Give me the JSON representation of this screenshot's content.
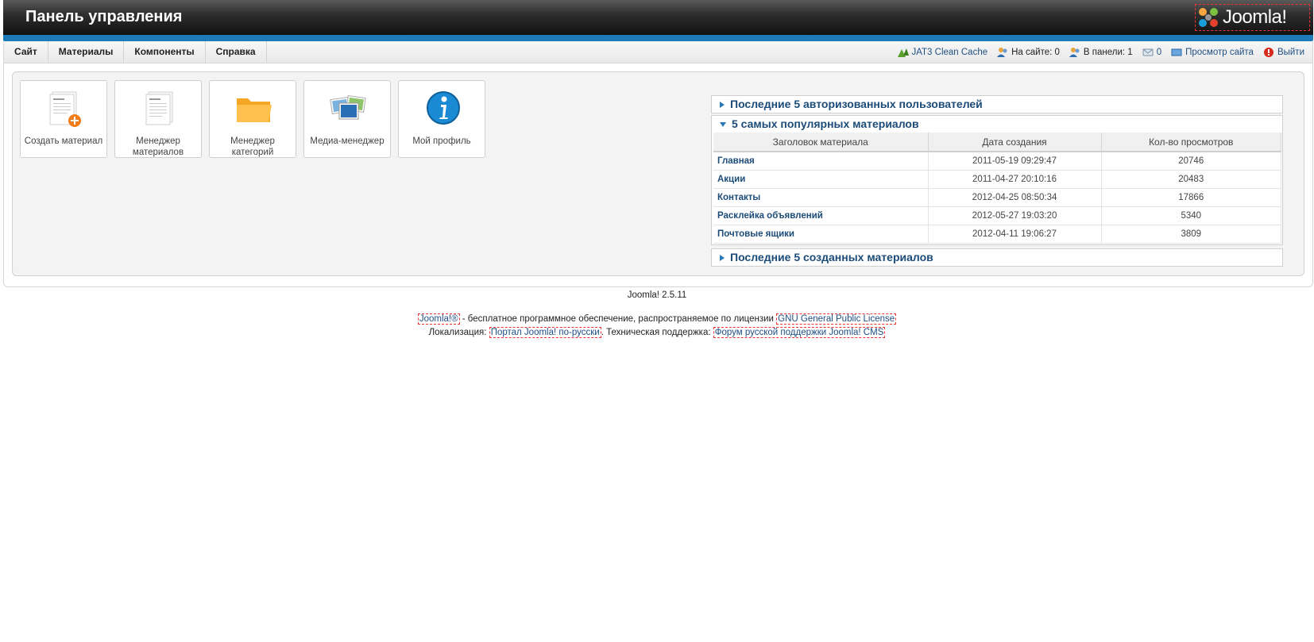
{
  "header": {
    "title": "Панель управления",
    "logo_text": "Joomla!"
  },
  "menu": {
    "items": [
      "Сайт",
      "Материалы",
      "Компоненты",
      "Справка"
    ]
  },
  "status": {
    "cache": "JAT3 Clean Cache",
    "on_site": "На сайте: 0",
    "in_panel": "В панели: 1",
    "messages": "0",
    "view_site": "Просмотр сайта",
    "logout": "Выйти"
  },
  "quickicons": [
    {
      "label": "Создать материал",
      "icon": "add-article-icon"
    },
    {
      "label": "Менеджер материалов",
      "icon": "article-manager-icon"
    },
    {
      "label": "Менеджер категорий",
      "icon": "folder-icon"
    },
    {
      "label": "Медиа-менеджер",
      "icon": "media-icon"
    },
    {
      "label": "Мой профиль",
      "icon": "info-icon"
    }
  ],
  "modules": {
    "logged": "Последние 5 авторизованных пользователей",
    "popular": "5 самых популярных материалов",
    "latest": "Последние 5 созданных материалов"
  },
  "popular_table": {
    "headers": [
      "Заголовок материала",
      "Дата создания",
      "Кол-во просмотров"
    ],
    "rows": [
      {
        "title": "Главная",
        "date": "2011-05-19 09:29:47",
        "hits": "20746"
      },
      {
        "title": "Акции",
        "date": "2011-04-27 20:10:16",
        "hits": "20483"
      },
      {
        "title": "Контакты",
        "date": "2012-04-25 08:50:34",
        "hits": "17866"
      },
      {
        "title": "Расклейка объявлений",
        "date": "2012-05-27 19:03:20",
        "hits": "5340"
      },
      {
        "title": "Почтовые ящики",
        "date": "2012-04-11 19:06:27",
        "hits": "3809"
      }
    ]
  },
  "footer": {
    "version": "Joomla! 2.5.11",
    "joomla_link": "Joomla!®",
    "license_text": " - бесплатное программное обеспечение, распространяемое по лицензии ",
    "license_link": "GNU General Public License",
    "loc_label": "Локализация: ",
    "loc_link": "Портал Joomla! по-русски",
    "support_label": ". Техническая поддержка: ",
    "support_link": "Форум русской поддержки Joomla! CMS"
  },
  "colors": {
    "accent": "#1e7bb8",
    "link": "#1b4b78"
  }
}
